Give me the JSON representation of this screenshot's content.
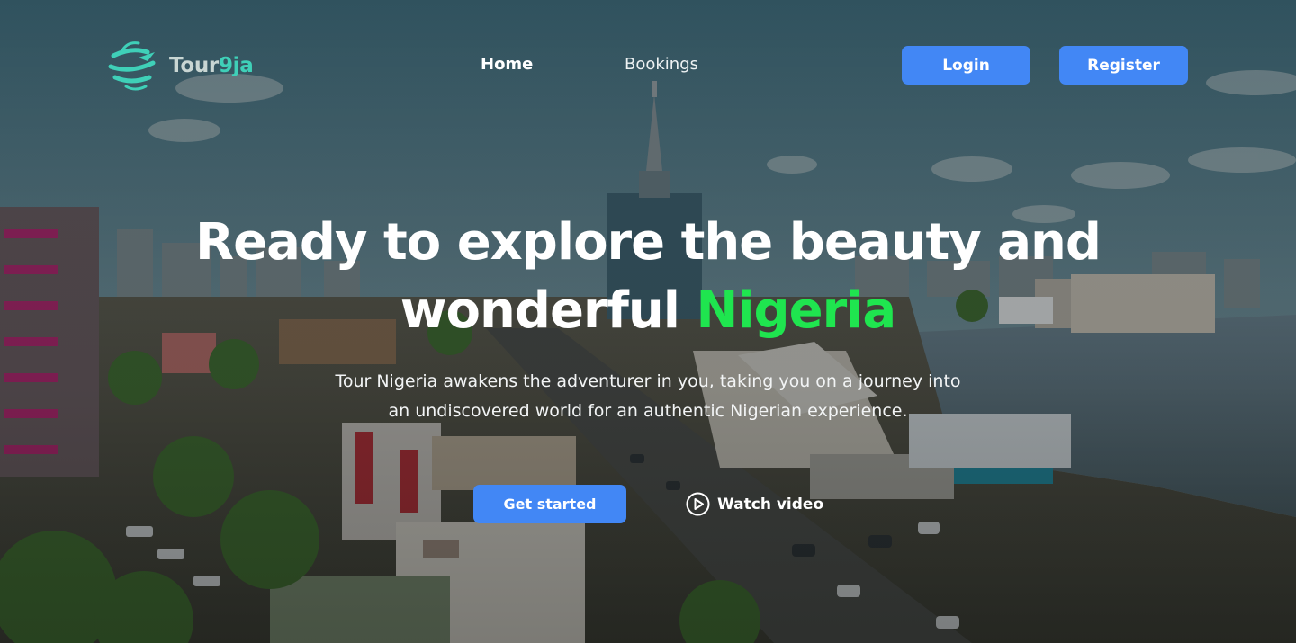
{
  "brand": {
    "name_prefix": "Tour",
    "name_suffix": "9ja",
    "logo_icon": "globe-plane-logo",
    "accent_color": "#3fd0b8"
  },
  "nav": {
    "items": [
      {
        "label": "Home",
        "active": true
      },
      {
        "label": "Bookings",
        "active": false
      }
    ],
    "login_label": "Login",
    "register_label": "Register"
  },
  "hero": {
    "title_line1": "Ready to explore the beauty and",
    "title_line2_prefix": "wonderful ",
    "title_line2_highlight": "Nigeria",
    "highlight_color": "#1fe54f",
    "subtitle_line1": "Tour Nigeria awakens the adventurer in you, taking you on a journey into",
    "subtitle_line2": "an undiscovered world for an authentic Nigerian experience.",
    "cta_label": "Get started",
    "video_label": "Watch video",
    "video_icon": "play-circle-icon"
  },
  "theme": {
    "button_color": "#4287f5"
  }
}
